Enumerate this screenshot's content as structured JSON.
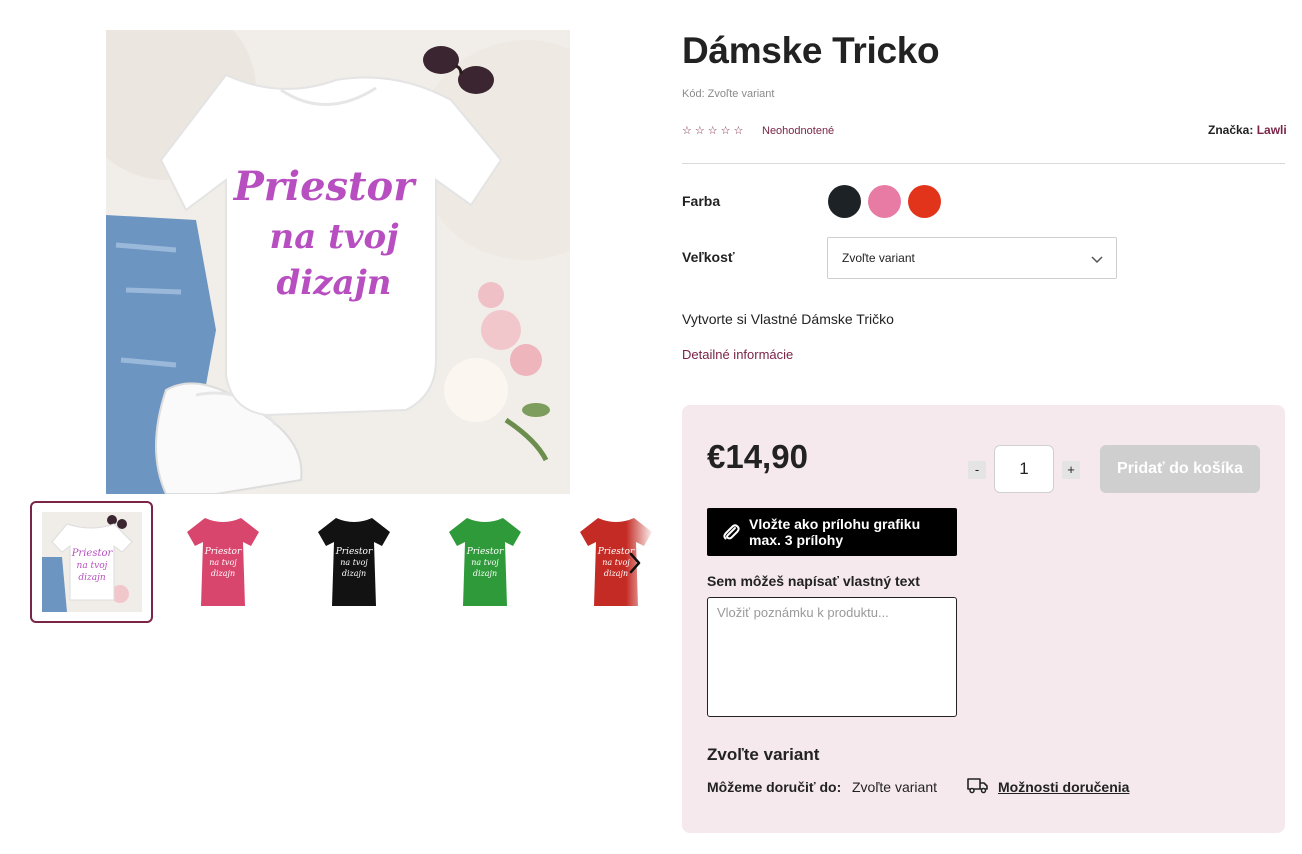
{
  "product": {
    "title": "Dámske Tricko",
    "code": "Kód: Zvoľte variant",
    "rating_text": "Neohodnotené",
    "stars": [
      "☆",
      "☆",
      "☆",
      "☆",
      "☆"
    ],
    "rating_value": 0,
    "brand_label": "Značka:",
    "brand_name": "Lawli",
    "description": "Vytvorte si Vlastné Dámske Tričko",
    "details_link": "Detailné informácie"
  },
  "gallery": {
    "main_image_text": [
      "Priestor",
      "na tvoj",
      "dizajn"
    ],
    "thumbnails": [
      {
        "name": "thumb-white",
        "color": "#ffffff",
        "active": true
      },
      {
        "name": "thumb-pink",
        "color": "#d9466d",
        "active": false
      },
      {
        "name": "thumb-black",
        "color": "#121212",
        "active": false
      },
      {
        "name": "thumb-green",
        "color": "#2f9a3a",
        "active": false
      },
      {
        "name": "thumb-red",
        "color": "#c42b24",
        "active": false
      }
    ],
    "next_icon": "chevron-right-icon"
  },
  "options": {
    "color_label": "Farba",
    "colors": [
      "#1d2226",
      "#e87ba3",
      "#e1341a"
    ],
    "size_label": "Veľkosť",
    "size_selected": "Zvoľte variant"
  },
  "buy": {
    "price": "€14,90",
    "qty_minus": "-",
    "qty_plus": "+",
    "qty_value": "1",
    "add_to_cart": "Pridať do košíka",
    "attach_line1": "Vložte ako prílohu grafiku",
    "attach_line2": "max. 3 prílohy",
    "note_label": "Sem môžeš napísať vlastný text",
    "note_placeholder": "Vložiť poznámku k produktu...",
    "variant_heading": "Zvoľte variant",
    "delivery_label": "Môžeme doručiť do:",
    "delivery_value": "Zvoľte variant",
    "delivery_link": "Možnosti doručenia"
  },
  "colors": {
    "accent": "#7a2447",
    "buybox_bg": "#f5e9ee",
    "print_text": "#b74fc0"
  }
}
